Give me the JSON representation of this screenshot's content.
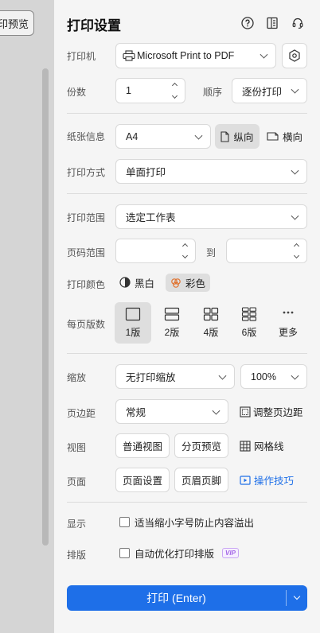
{
  "left": {
    "preview_label": "打印预览"
  },
  "header": {
    "title": "打印设置"
  },
  "printer": {
    "label": "打印机",
    "value": "Microsoft Print to PDF"
  },
  "copies": {
    "label": "份数",
    "value": "1"
  },
  "order": {
    "label": "顺序",
    "value": "逐份打印"
  },
  "paper": {
    "label": "纸张信息",
    "size": "A4",
    "portrait": "纵向",
    "landscape": "横向"
  },
  "print_mode": {
    "label": "打印方式",
    "value": "单面打印"
  },
  "range": {
    "label": "打印范围",
    "value": "选定工作表"
  },
  "page_range": {
    "label": "页码范围",
    "to": "到",
    "from_value": "",
    "to_value": ""
  },
  "color": {
    "label": "打印颜色",
    "bw": "黑白",
    "color": "彩色"
  },
  "pages_per_sheet": {
    "label": "每页版数",
    "options": [
      {
        "label": "1版",
        "selected": true
      },
      {
        "label": "2版",
        "selected": false
      },
      {
        "label": "4版",
        "selected": false
      },
      {
        "label": "6版",
        "selected": false
      },
      {
        "label": "更多",
        "selected": false
      }
    ]
  },
  "scale": {
    "label": "缩放",
    "value": "无打印缩放",
    "percent": "100%"
  },
  "margin": {
    "label": "页边距",
    "value": "常规",
    "adjust": "调整页边距"
  },
  "view": {
    "label": "视图",
    "normal": "普通视图",
    "page_break": "分页预览",
    "gridlines": "网格线"
  },
  "page": {
    "label": "页面",
    "setup": "页面设置",
    "header_footer": "页眉页脚",
    "tips": "操作技巧"
  },
  "display": {
    "label": "显示",
    "option": "适当缩小字号防止内容溢出"
  },
  "typeset": {
    "label": "排版",
    "option": "自动优化打印排版",
    "vip": "VIP"
  },
  "print_button": {
    "label": "打印 (Enter)"
  },
  "colors": {
    "accent": "#1e6fe8",
    "vip": "#a466e6",
    "color_icon": "#e0722f"
  }
}
